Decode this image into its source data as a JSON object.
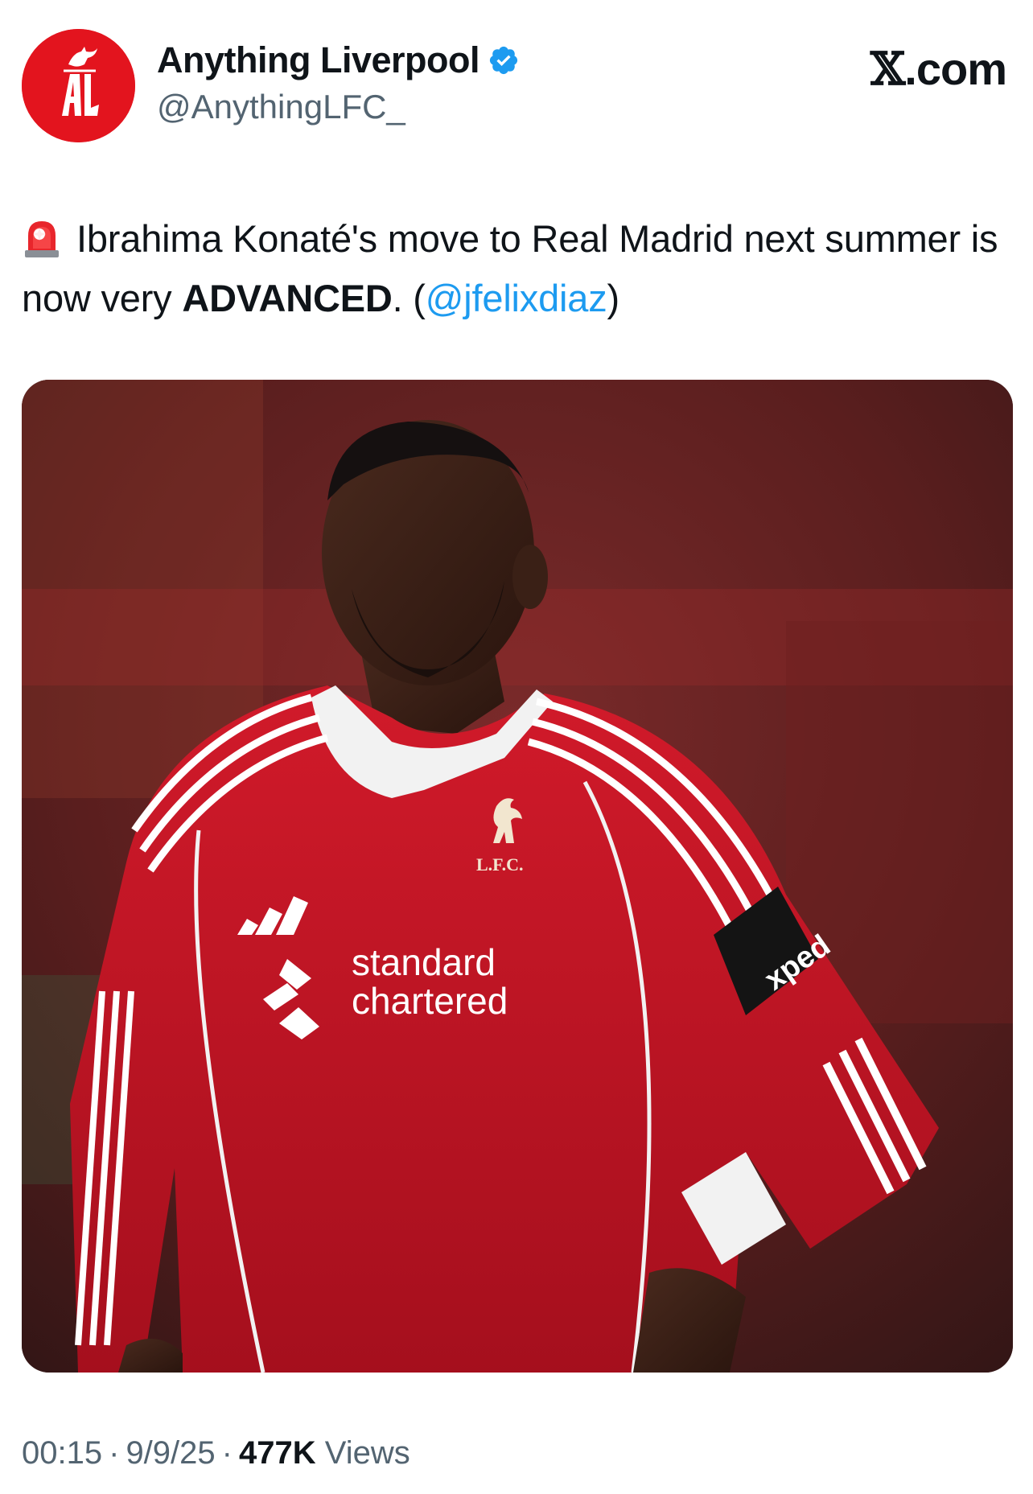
{
  "account": {
    "display_name": "Anything Liverpool",
    "handle": "@AnythingLFC_",
    "verified": true,
    "avatar_color": "#e3141e",
    "avatar_icon": "liverbird-al-logo"
  },
  "brand": {
    "x_glyph": "𝕏",
    "suffix": ".com"
  },
  "tweet": {
    "icon": "siren-icon",
    "text_part1": "Ibrahima Konaté's move to Real Madrid next summer is now very ",
    "text_bold": "ADVANCED",
    "text_part2": ". (",
    "mention": "@jfelixdiaz",
    "text_part3": ")"
  },
  "media": {
    "description_icon": "player-photo",
    "shirt_sponsor_line1": "standard",
    "shirt_sponsor_line2": "chartered",
    "crest_text": "L.F.C.",
    "sleeve_sponsor": "xped",
    "shirt_color": "#c8102e"
  },
  "meta": {
    "time": "00:15",
    "date": "9/9/25",
    "separator": "·",
    "views_count": "477K",
    "views_label": "Views"
  },
  "colors": {
    "link": "#1d9bf0",
    "secondary_text": "#536471",
    "text": "#0f1419"
  }
}
